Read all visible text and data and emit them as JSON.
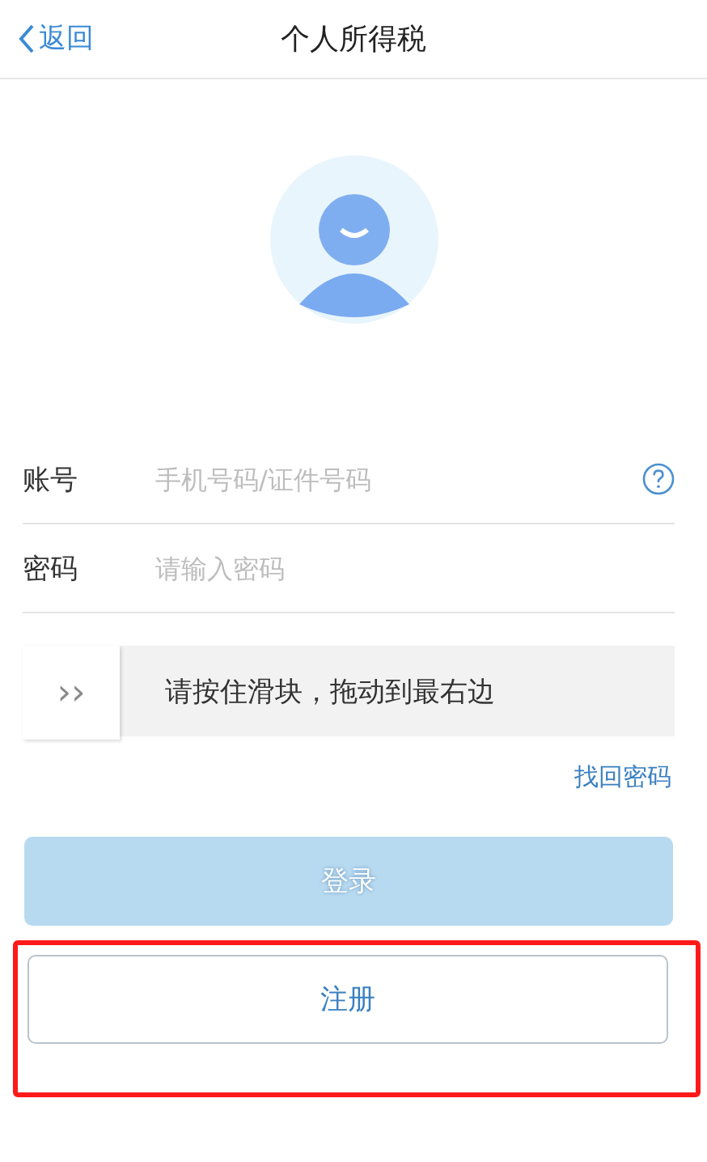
{
  "header": {
    "back": "返回",
    "title": "个人所得税"
  },
  "fields": [
    {
      "label": "账号",
      "placeholder": "手机号码/证件号码",
      "help": true
    },
    {
      "label": "密码",
      "placeholder": "请输入密码",
      "help": false
    }
  ],
  "slider": {
    "handle": "››",
    "text": "请按住滑块，拖动到最右边",
    "level": 0
  },
  "forgot_link": "找回密码",
  "login_button": {
    "label": "登录",
    "disabled": true
  },
  "register_button": {
    "label": "注册",
    "highlighted": true
  }
}
